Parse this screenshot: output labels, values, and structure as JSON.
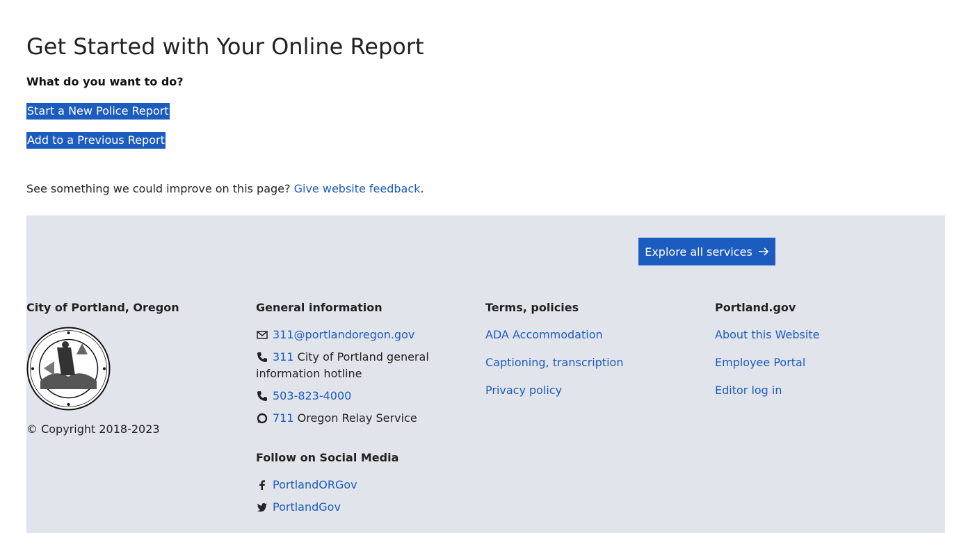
{
  "main": {
    "title": "Get Started with Your Online Report",
    "question": "What do you want to do?",
    "links": [
      {
        "label": "Start a New Police Report"
      },
      {
        "label": "Add to a Previous Report"
      }
    ],
    "feedback_prefix": "See something we could improve on this page?",
    "feedback_link": "Give website feedback",
    "feedback_suffix": "."
  },
  "footer": {
    "explore_label": "Explore all services",
    "city": {
      "heading": "City of Portland, Oregon",
      "seal_icon": "city-seal-icon",
      "copyright": "© Copyright 2018-2023"
    },
    "general": {
      "heading": "General information",
      "email": "311@portlandoregon.gov",
      "phone311": "311",
      "phone311_text": "City of Portland general information hotline",
      "phone_main": "503-823-4000",
      "relay": "711",
      "relay_text": "Oregon Relay Service",
      "social_heading": "Follow on Social Media",
      "facebook": "PortlandORGov",
      "twitter": "PortlandGov"
    },
    "terms": {
      "heading": "Terms, policies",
      "items": [
        "ADA Accommodation",
        "Captioning, transcription",
        "Privacy policy"
      ]
    },
    "portland": {
      "heading": "Portland.gov",
      "items": [
        "About this Website",
        "Employee Portal",
        "Editor log in"
      ]
    }
  },
  "colors": {
    "link": "#1c5cbf",
    "footer_bg": "#e1e4ea",
    "text": "#222222"
  }
}
